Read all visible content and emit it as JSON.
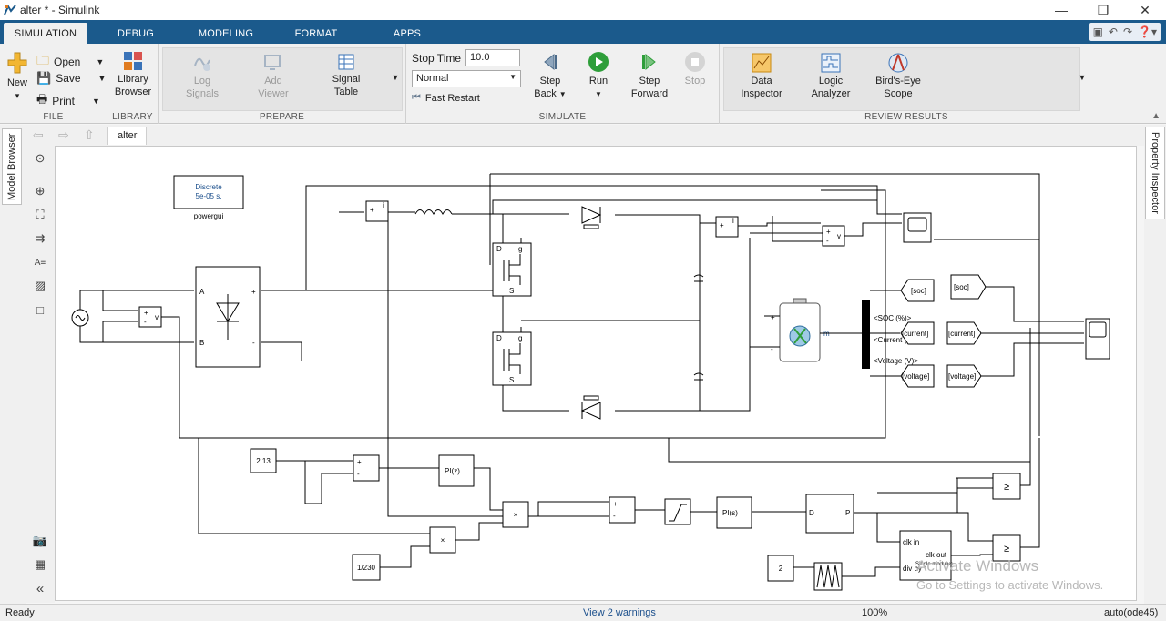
{
  "window": {
    "title": "alter * - Simulink",
    "minimize": "—",
    "restore": "❐",
    "close": "✕"
  },
  "tabs": [
    {
      "label": "SIMULATION"
    },
    {
      "label": "DEBUG"
    },
    {
      "label": "MODELING"
    },
    {
      "label": "FORMAT"
    },
    {
      "label": "APPS"
    }
  ],
  "ribbon": {
    "file": {
      "section": "FILE",
      "new": "New",
      "open": "Open",
      "save": "Save",
      "print": "Print"
    },
    "library": {
      "section": "LIBRARY",
      "browser_line1": "Library",
      "browser_line2": "Browser"
    },
    "prepare": {
      "section": "PREPARE",
      "log1": "Log",
      "log2": "Signals",
      "add1": "Add",
      "add2": "Viewer",
      "sig1": "Signal",
      "sig2": "Table"
    },
    "simulate": {
      "section": "SIMULATE",
      "stop_time_label": "Stop Time",
      "stop_time_value": "10.0",
      "mode_value": "Normal",
      "fast_restart": "Fast Restart",
      "step_back1": "Step",
      "step_back2": "Back",
      "run": "Run",
      "step_fwd1": "Step",
      "step_fwd2": "Forward",
      "stop": "Stop"
    },
    "review": {
      "section": "REVIEW RESULTS",
      "data1": "Data",
      "data2": "Inspector",
      "logic1": "Logic",
      "logic2": "Analyzer",
      "bird1": "Bird's-Eye",
      "bird2": "Scope"
    }
  },
  "leftpanel": {
    "model_browser": "Model Browser"
  },
  "rightpanel": {
    "property_inspector": "Property Inspector"
  },
  "breadcrumb": "alter",
  "diagram": {
    "powergui_line1": "Discrete",
    "powergui_line2": "5e-05 s.",
    "powergui_label": "powergui",
    "rect_A": "A",
    "rect_B": "B",
    "plus": "+",
    "minus": "-",
    "meas_v": "v",
    "meas_i": "i",
    "goto_soc": "[soc]",
    "goto_current": "[current]",
    "goto_voltage": "[voltage]",
    "from_soc": "[soc]",
    "from_current": "[current]",
    "from_voltage": "[voltage]",
    "bat_soc": "<SOC (%)>",
    "bat_current": "<Current (A)>",
    "bat_voltage": "<Voltage (V)>",
    "bat_m": "m",
    "const_213": "2.13",
    "const_1230": "1/230",
    "const_2": "2",
    "pi_z": "PI(z)",
    "pi_s": "PI(s)",
    "d_label": "D",
    "p_label": "P",
    "mult": "×",
    "ge": "≥",
    "clk_in": "clk in",
    "clk_out": "clk out",
    "div_by": "div by",
    "single_modulus": "Single modulus",
    "mosfet_g": "g",
    "mosfet_d": "D",
    "mosfet_s": "S"
  },
  "watermark": {
    "line1": "Activate Windows",
    "line2": "Go to Settings to activate Windows."
  },
  "status": {
    "ready": "Ready",
    "warnings": "View 2 warnings",
    "zoom": "100%",
    "solver": "auto(ode45)"
  },
  "colors": {
    "tab_blue": "#1b5a8c",
    "run_green": "#2e9e3a"
  }
}
